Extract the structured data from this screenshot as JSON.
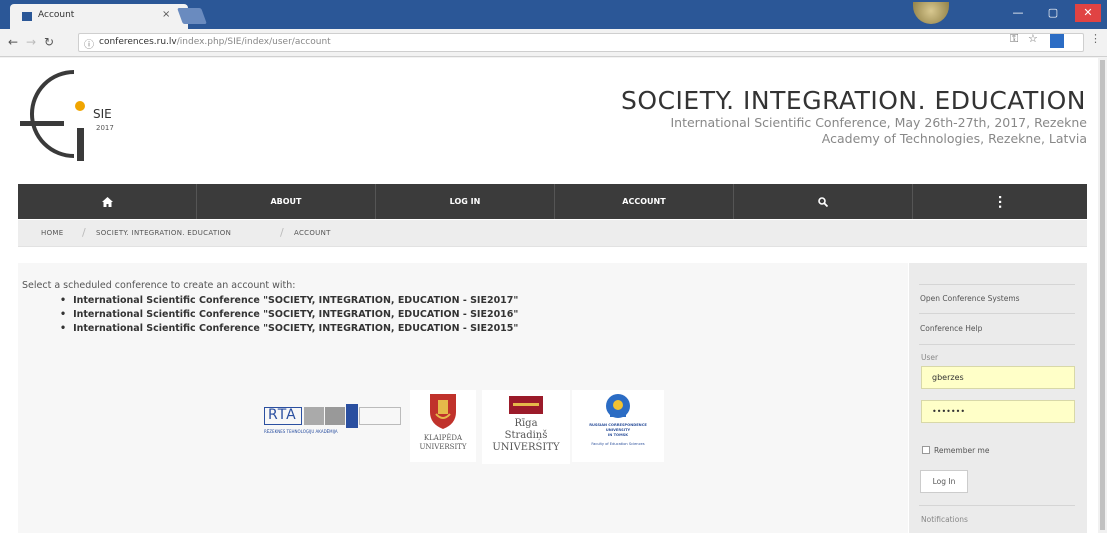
{
  "browser": {
    "tab_title": "Account",
    "tab_close": "×",
    "url_host": "conferences.ru.lv",
    "url_path": "/index.php/SIE/index/user/account",
    "info_icon": "ⓘ",
    "window_controls": [
      "—",
      "▢",
      "✕"
    ]
  },
  "header": {
    "logo_text": "SIE",
    "logo_year": "2017",
    "title": "SOCIETY. INTEGRATION. EDUCATION",
    "subtitle_line1": "International Scientific Conference, May 26th-27th, 2017, Rezekne",
    "subtitle_line2": "Academy of Technologies, Rezekne, Latvia"
  },
  "nav": {
    "home_icon": "home-icon",
    "about": "ABOUT",
    "login": "LOG IN",
    "account": "ACCOUNT",
    "search_icon": "search-icon",
    "more_icon": "more-vertical-icon"
  },
  "breadcrumb": {
    "home": "HOME",
    "conference": "SOCIETY. INTEGRATION. EDUCATION",
    "current": "ACCOUNT"
  },
  "main": {
    "intro": "Select a scheduled conference to create an account with:",
    "conferences": [
      "International Scientific Conference \"SOCIETY, INTEGRATION, EDUCATION - SIE2017\"",
      "International Scientific Conference \"SOCIETY, INTEGRATION, EDUCATION - SIE2016\"",
      "International Scientific Conference \"SOCIETY, INTEGRATION, EDUCATION - SIE2015\""
    ],
    "partners": {
      "rta_name": "RTA",
      "rta_caption": "RĒZEKNES TEHNOLOĢIJU AKADĒMIJA",
      "klaipeda_line1": "KLAIPĖDA",
      "klaipeda_line2": "UNIVERSITY",
      "riga_line1": "Rīga",
      "riga_line2": "Stradiņš",
      "riga_line3": "UNIVERSITY",
      "russian_line1": "RUSSIAN CORRESPONDENCE",
      "russian_line2": "UNIVERSITY",
      "russian_line3": "IN TOMSK",
      "russian_line4": "Faculty of Education Sciences"
    }
  },
  "sidebar": {
    "ocs_link": "Open Conference Systems",
    "help_link": "Conference Help",
    "user_label": "User",
    "username": "gberzes",
    "password": "•••••••",
    "remember": "Remember me",
    "login_button": "Log In",
    "notifications": "Notifications"
  },
  "colors": {
    "chrome_blue": "#2b5797",
    "nav_dark": "#3b3b3b",
    "input_yellow": "#ffffc8",
    "sidebar_bg": "#ebebeb"
  }
}
